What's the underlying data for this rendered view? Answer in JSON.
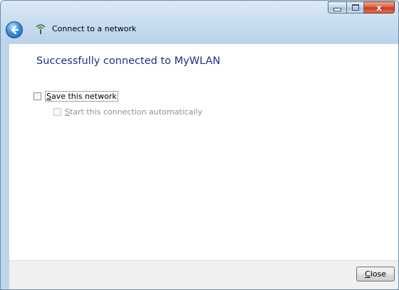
{
  "window": {
    "title": "Connect to a network",
    "close_glyph": "x"
  },
  "icons": {
    "back": "back-arrow-icon",
    "network": "wireless-network-icon"
  },
  "content": {
    "heading": "Successfully connected to MyWLAN",
    "save_network": {
      "accel": "S",
      "rest": "ave this network",
      "checked": false
    },
    "start_automatically": {
      "accel": "S",
      "rest": "tart this connection automatically",
      "checked": false,
      "enabled": false
    }
  },
  "footer": {
    "close_accel": "C",
    "close_rest": "lose"
  },
  "colors": {
    "heading": "#1e3287",
    "frame": "#bfd5ea"
  }
}
